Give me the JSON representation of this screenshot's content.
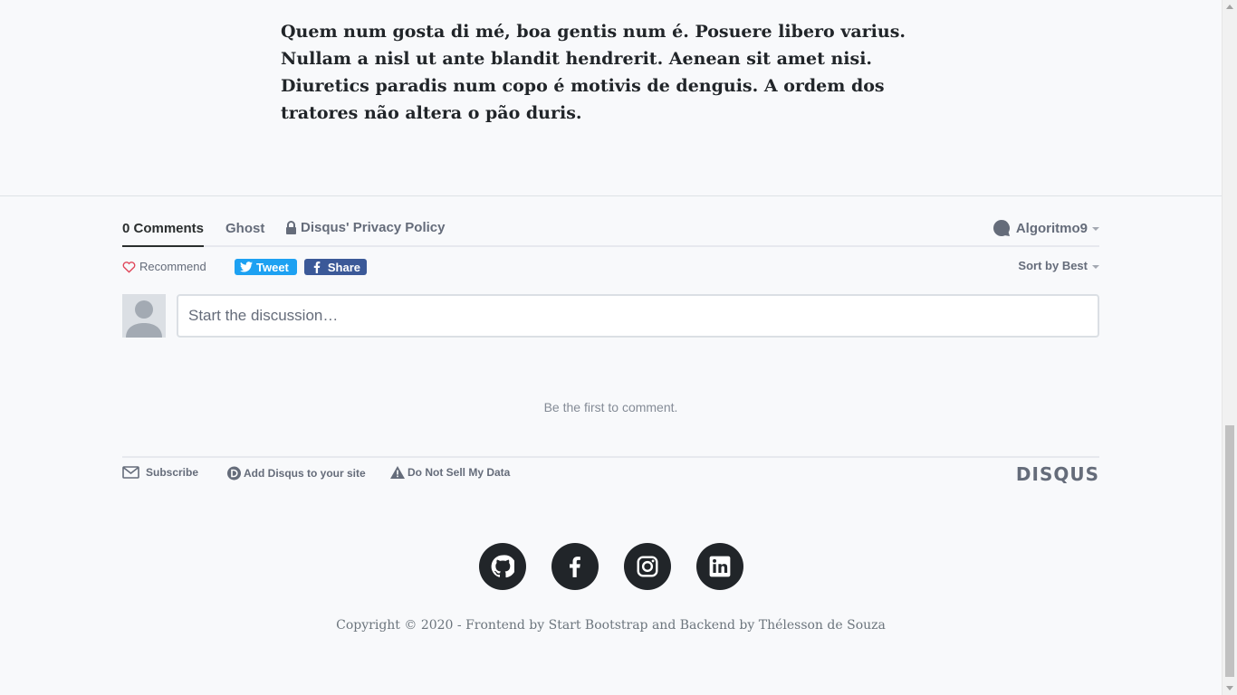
{
  "article": {
    "paragraph": "Quem num gosta di mé, boa gentis num é. Posuere libero varius. Nullam a nisl ut ante blandit hendrerit. Aenean sit amet nisi. Diuretics paradis num copo é motivis de denguis. A ordem dos tratores não altera o pão duris."
  },
  "disqus": {
    "tabs": {
      "comments": "0 Comments",
      "community": "Ghost",
      "privacy": "Disqus' Privacy Policy"
    },
    "user": "Algoritmo9",
    "recommend": "Recommend",
    "tweet": "Tweet",
    "share": "Share",
    "sort": "Sort by Best",
    "compose_placeholder": "Start the discussion…",
    "empty_message": "Be the first to comment.",
    "footer": {
      "subscribe": "Subscribe",
      "add_disqus": "Add Disqus to your site",
      "do_not_sell": "Do Not Sell My Data",
      "logo": "DISQUS"
    },
    "colors": {
      "tweet": "#1da1f2",
      "facebook": "#3b5998",
      "text_muted": "#656c7a"
    }
  },
  "social": {
    "icons": [
      "github-icon",
      "facebook-icon",
      "instagram-icon",
      "linkedin-icon"
    ]
  },
  "copyright": "Copyright © 2020 - Frontend by Start Bootstrap and Backend by Thélesson de Souza"
}
